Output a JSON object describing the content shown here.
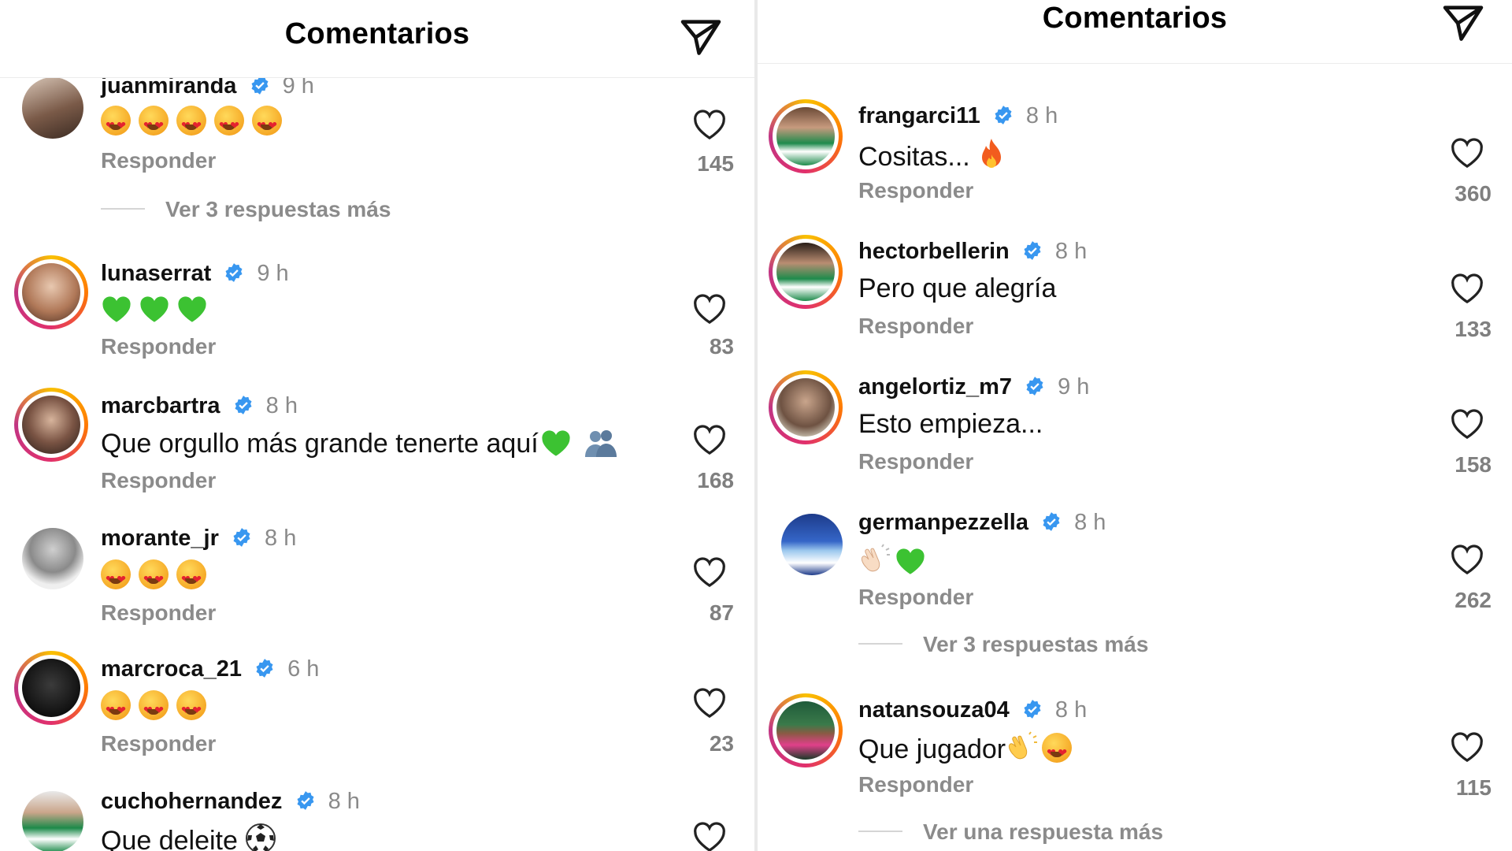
{
  "colors": {
    "verified": "#3897f0",
    "ring_start": "#f9c000",
    "ring_end": "#c13584",
    "muted": "#8b8b8b"
  },
  "left": {
    "header": {
      "title": "Comentarios"
    },
    "comments": [
      {
        "username": "juanmiranda",
        "time": "9 h",
        "text": "",
        "emojis": [
          "heart-eyes",
          "heart-eyes",
          "heart-eyes",
          "heart-eyes",
          "heart-eyes"
        ],
        "reply": "Responder",
        "likes": "145",
        "more": "Ver 3 respuestas más",
        "ring": false
      },
      {
        "username": "lunaserrat",
        "time": "9 h",
        "text": "",
        "emojis": [
          "green-heart",
          "green-heart",
          "green-heart"
        ],
        "reply": "Responder",
        "likes": "83",
        "ring": true
      },
      {
        "username": "marcbartra",
        "time": "8 h",
        "text": "Que orgullo más grande tenerte aquí",
        "emojis": [
          "green-heart",
          "hug"
        ],
        "reply": "Responder",
        "likes": "168",
        "ring": true
      },
      {
        "username": "morante_jr",
        "time": "8 h",
        "text": "",
        "emojis": [
          "heart-eyes",
          "heart-eyes",
          "heart-eyes"
        ],
        "reply": "Responder",
        "likes": "87",
        "ring": false
      },
      {
        "username": "marcroca_21",
        "time": "6 h",
        "text": "",
        "emojis": [
          "heart-eyes",
          "heart-eyes",
          "heart-eyes"
        ],
        "reply": "Responder",
        "likes": "23",
        "ring": true
      },
      {
        "username": "cuchohernandez",
        "time": "8 h",
        "text": "Que deleite",
        "emojis": [
          "soccer-ball"
        ],
        "reply": "",
        "likes": "",
        "ring": false
      }
    ]
  },
  "right": {
    "header": {
      "title": "Comentarios"
    },
    "comments": [
      {
        "username": "frangarci11",
        "time": "8 h",
        "text": "Cositas...",
        "emojis": [
          "fire"
        ],
        "reply": "Responder",
        "likes": "360",
        "ring": true
      },
      {
        "username": "hectorbellerin",
        "time": "8 h",
        "text": "Pero que alegría",
        "emojis": [],
        "reply": "Responder",
        "likes": "133",
        "ring": true
      },
      {
        "username": "angelortiz_m7",
        "time": "9 h",
        "text": "Esto empieza...",
        "emojis": [],
        "reply": "Responder",
        "likes": "158",
        "ring": true
      },
      {
        "username": "germanpezzella",
        "time": "8 h",
        "text": "",
        "emojis": [
          "clapping-hands",
          "green-heart"
        ],
        "reply": "Responder",
        "likes": "262",
        "more": "Ver 3 respuestas más",
        "ring": false
      },
      {
        "username": "natansouza04",
        "time": "8 h",
        "text": "Que jugador",
        "emojis": [
          "clapping-hands",
          "heart-eyes"
        ],
        "reply": "Responder",
        "likes": "115",
        "more": "Ver una respuesta más",
        "ring": true
      }
    ]
  }
}
